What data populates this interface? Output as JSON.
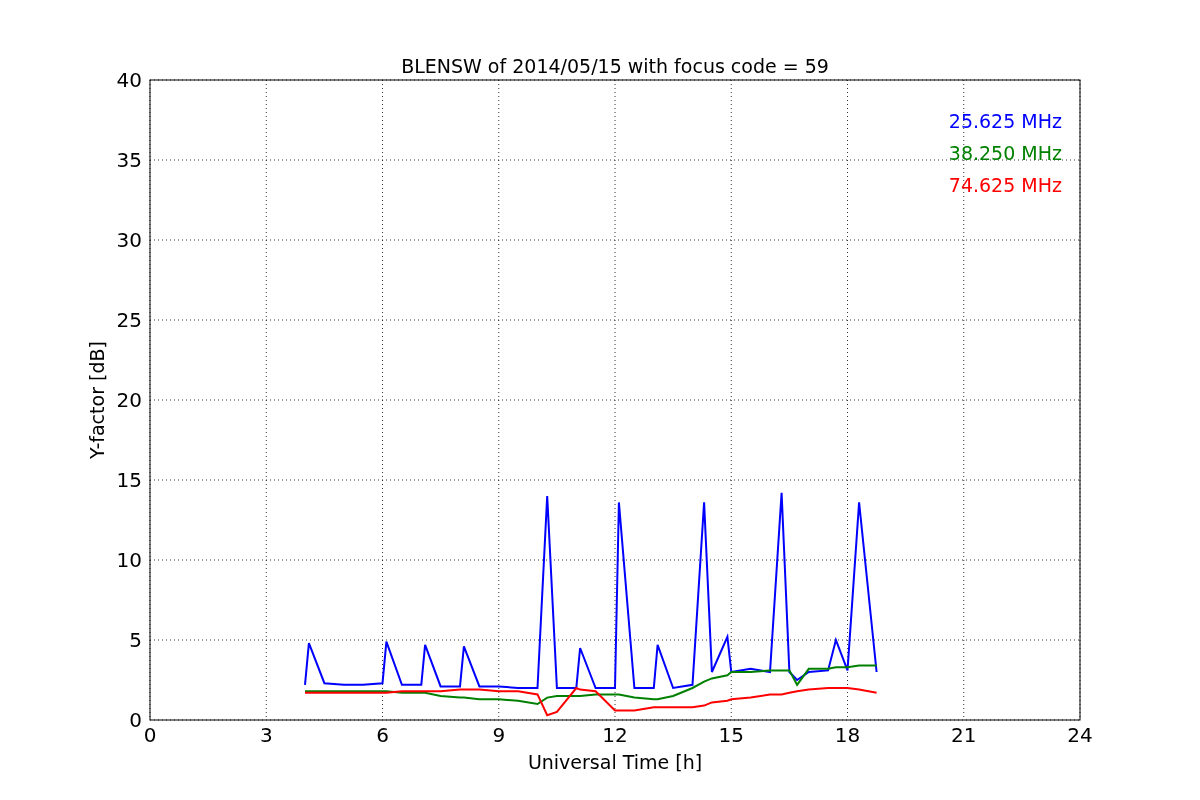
{
  "figure": {
    "chart_data": {
      "type": "line",
      "title": "BLENSW of 2014/05/15 with focus code = 59",
      "xlabel": "Universal Time [h]",
      "ylabel": "Y-factor [dB]",
      "x": [
        4,
        4.1,
        4.5,
        5,
        5.5,
        6,
        6.1,
        6.5,
        7,
        7.1,
        7.5,
        8,
        8.1,
        8.5,
        9,
        9.5,
        10,
        10.25,
        10.5,
        11,
        11.1,
        11.5,
        12,
        12.1,
        12.5,
        13,
        13.1,
        13.5,
        14,
        14.3,
        14.5,
        14.9,
        15,
        15.5,
        16,
        16.3,
        16.5,
        16.7,
        17,
        17.5,
        17.7,
        18,
        18.3,
        18.75
      ],
      "series": [
        {
          "name": "25.625 MHz",
          "color": "#0000ff",
          "values": [
            2.2,
            4.8,
            2.3,
            2.2,
            2.2,
            2.3,
            4.9,
            2.2,
            2.2,
            4.7,
            2.1,
            2.1,
            4.6,
            2.1,
            2.1,
            2.0,
            2.0,
            14,
            2.0,
            2.0,
            4.5,
            2.0,
            2.0,
            13.6,
            2.0,
            2.0,
            4.7,
            2.0,
            2.2,
            13.6,
            3.0,
            5.2,
            3.0,
            3.2,
            3.0,
            14.2,
            3.0,
            2.5,
            3.0,
            3.1,
            5.0,
            3.1,
            13.6,
            3.0
          ]
        },
        {
          "name": "38.250 MHz",
          "color": "#008000",
          "values": [
            1.8,
            1.8,
            1.8,
            1.8,
            1.8,
            1.8,
            1.8,
            1.7,
            1.7,
            1.7,
            1.5,
            1.4,
            1.4,
            1.3,
            1.3,
            1.2,
            1.0,
            1.4,
            1.5,
            1.5,
            1.5,
            1.6,
            1.6,
            1.6,
            1.4,
            1.3,
            1.3,
            1.5,
            2.0,
            2.4,
            2.6,
            2.8,
            3.0,
            3.0,
            3.1,
            3.1,
            3.1,
            2.2,
            3.2,
            3.2,
            3.3,
            3.3,
            3.4,
            3.4
          ]
        },
        {
          "name": "74.625 MHz",
          "color": "#ff0000",
          "values": [
            1.7,
            1.7,
            1.7,
            1.7,
            1.7,
            1.7,
            1.7,
            1.8,
            1.8,
            1.8,
            1.8,
            1.9,
            1.9,
            1.9,
            1.8,
            1.8,
            1.6,
            0.3,
            0.5,
            2.0,
            1.9,
            1.8,
            0.6,
            0.6,
            0.6,
            0.8,
            0.8,
            0.8,
            0.8,
            0.9,
            1.1,
            1.2,
            1.3,
            1.4,
            1.6,
            1.6,
            1.7,
            1.8,
            1.9,
            2.0,
            2.0,
            2.0,
            1.9,
            1.7
          ]
        }
      ],
      "grid": true,
      "xlim": [
        0,
        24
      ],
      "ylim": [
        0,
        40
      ],
      "xticks": [
        0,
        3,
        6,
        9,
        12,
        15,
        18,
        21,
        24
      ],
      "yticks": [
        0,
        5,
        10,
        15,
        20,
        25,
        30,
        35,
        40
      ]
    }
  }
}
